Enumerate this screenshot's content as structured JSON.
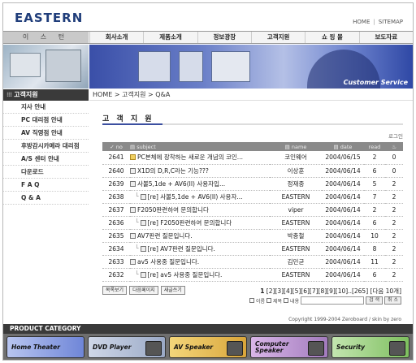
{
  "header": {
    "logo": "EASTERN",
    "home_link": "HOME",
    "sitemap_link": "SITEMAP"
  },
  "nav": {
    "brand": "이 스 턴",
    "items": [
      "회사소개",
      "제품소개",
      "정보광장",
      "고객지원",
      "쇼 핑 몰",
      "보도자료"
    ]
  },
  "banner": {
    "text": "Customer Service"
  },
  "sidebar": {
    "title": "고객지원",
    "items": [
      "지사 안내",
      "PC 대리점 안내",
      "AV 직영점 안내",
      "후방감시카메라 대리점",
      "A/S 센터 안내",
      "다운로드",
      "F A Q",
      "Q & A"
    ]
  },
  "breadcrumb": "HOME > 고객지원 > Q&A",
  "page_title": "고 객 지 원",
  "login_label": "로그인",
  "board": {
    "columns": [
      "no",
      "subject",
      "name",
      "date",
      "read",
      "♨"
    ],
    "rows": [
      {
        "no": "2641",
        "subject": "PC본체에 장착하는 새로운 개념의 코인...",
        "name": "코인웨어",
        "date": "2004/06/15",
        "read": "2",
        "vote": "0",
        "reply": false,
        "hot": true
      },
      {
        "no": "2640",
        "subject": "X1D의 D,R,C라는 기능???",
        "name": "이상훈",
        "date": "2004/06/14",
        "read": "6",
        "vote": "0",
        "reply": false,
        "hot": false
      },
      {
        "no": "2639",
        "subject": "사볼5,1de + AV6(II) 사용자입...",
        "name": "정재중",
        "date": "2004/06/14",
        "read": "5",
        "vote": "2",
        "reply": false,
        "hot": false
      },
      {
        "no": "2638",
        "subject": "[re] 사볼5,1de + AV6(II) 사용자...",
        "name": "EASTERN",
        "date": "2004/06/14",
        "read": "7",
        "vote": "2",
        "reply": true,
        "hot": false
      },
      {
        "no": "2637",
        "subject": "F2050판련하여 문의합니다",
        "name": "viper",
        "date": "2004/06/14",
        "read": "2",
        "vote": "2",
        "reply": false,
        "hot": false
      },
      {
        "no": "2636",
        "subject": "[re] F2050판련하여 문의합니다",
        "name": "EASTERN",
        "date": "2004/06/14",
        "read": "6",
        "vote": "2",
        "reply": true,
        "hot": false
      },
      {
        "no": "2635",
        "subject": "AV7판련 질문입니다.",
        "name": "박충철",
        "date": "2004/06/14",
        "read": "10",
        "vote": "2",
        "reply": false,
        "hot": false
      },
      {
        "no": "2634",
        "subject": "[re] AV7판련 질문입니다.",
        "name": "EASTERN",
        "date": "2004/06/14",
        "read": "8",
        "vote": "2",
        "reply": true,
        "hot": false
      },
      {
        "no": "2633",
        "subject": "av5 사용중 질문입니다.",
        "name": "김민균",
        "date": "2004/06/14",
        "read": "11",
        "vote": "2",
        "reply": false,
        "hot": false
      },
      {
        "no": "2632",
        "subject": "[re] av5 사용중 질문입니다.",
        "name": "EASTERN",
        "date": "2004/06/14",
        "read": "6",
        "vote": "2",
        "reply": true,
        "hot": false
      }
    ]
  },
  "buttons": {
    "list": "목록보기",
    "next": "다음페이지",
    "write": "새글쓰기"
  },
  "pager": {
    "current": "1",
    "pages": "[2][3][4][5][6][7][8][9][10]..[265]",
    "next10": "[다음 10개]"
  },
  "search": {
    "opt_name": "이름",
    "opt_subject": "제목",
    "opt_content": "내용",
    "search_btn": "검 색",
    "cancel_btn": "취 소"
  },
  "copyright": "Copyright 1999-2004 Zeroboard / skin by zero",
  "product_category": {
    "title": "PRODUCT CATEGORY",
    "items": [
      "Home Theater",
      "DVD Player",
      "AV Speaker",
      "Computer Speaker",
      "Security"
    ]
  }
}
